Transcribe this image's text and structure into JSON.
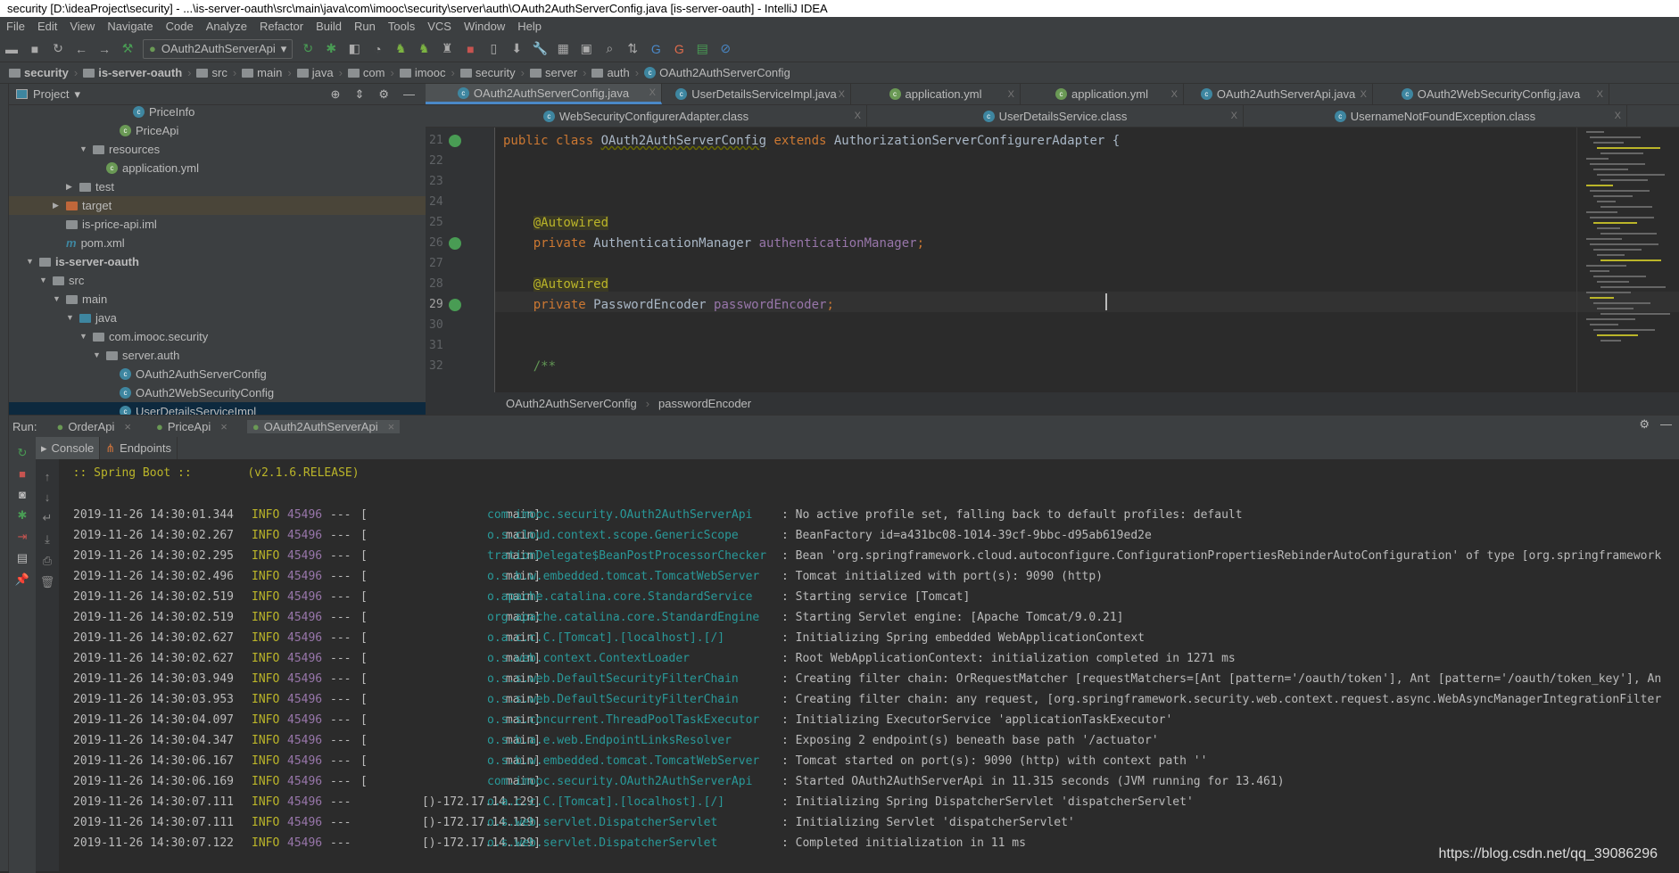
{
  "window": {
    "title": "security [D:\\ideaProject\\security] - ...\\is-server-oauth\\src\\main\\java\\com\\imooc\\security\\server\\auth\\OAuth2AuthServerConfig.java [is-server-oauth] - IntelliJ IDEA"
  },
  "menu": [
    "File",
    "Edit",
    "View",
    "Navigate",
    "Code",
    "Analyze",
    "Refactor",
    "Build",
    "Run",
    "Tools",
    "VCS",
    "Window",
    "Help"
  ],
  "toolbar": {
    "run_config": "OAuth2AuthServerApi"
  },
  "breadcrumb": [
    "security",
    "is-server-oauth",
    "src",
    "main",
    "java",
    "com",
    "imooc",
    "security",
    "server",
    "auth",
    "OAuth2AuthServerConfig"
  ],
  "project": {
    "title": "Project",
    "tree": [
      {
        "label": "PriceInfo",
        "depth": 8,
        "icon": "class"
      },
      {
        "label": "PriceApi",
        "depth": 7,
        "icon": "spring-class"
      },
      {
        "label": "resources",
        "depth": 5,
        "icon": "folder",
        "open": true
      },
      {
        "label": "application.yml",
        "depth": 6,
        "icon": "yml"
      },
      {
        "label": "test",
        "depth": 4,
        "icon": "folder",
        "open": false
      },
      {
        "label": "target",
        "depth": 3,
        "icon": "folder-orange",
        "open": false
      },
      {
        "label": "is-price-api.iml",
        "depth": 3,
        "icon": "file"
      },
      {
        "label": "pom.xml",
        "depth": 3,
        "icon": "maven"
      },
      {
        "label": "is-server-oauth",
        "depth": 1,
        "icon": "module",
        "open": true
      },
      {
        "label": "src",
        "depth": 2,
        "icon": "folder",
        "open": true
      },
      {
        "label": "main",
        "depth": 3,
        "icon": "folder",
        "open": true
      },
      {
        "label": "java",
        "depth": 4,
        "icon": "folder-blue",
        "open": true
      },
      {
        "label": "com.imooc.security",
        "depth": 5,
        "icon": "package",
        "open": true
      },
      {
        "label": "server.auth",
        "depth": 6,
        "icon": "package",
        "open": true
      },
      {
        "label": "OAuth2AuthServerConfig",
        "depth": 7,
        "icon": "class"
      },
      {
        "label": "OAuth2WebSecurityConfig",
        "depth": 7,
        "icon": "class"
      },
      {
        "label": "UserDetailsServiceImpl",
        "depth": 7,
        "icon": "class",
        "selected": true
      }
    ]
  },
  "tabs_row1": [
    {
      "label": "OAuth2AuthServerConfig.java",
      "active": true
    },
    {
      "label": "UserDetailsServiceImpl.java"
    },
    {
      "label": "application.yml"
    },
    {
      "label": "application.yml"
    },
    {
      "label": "OAuth2AuthServerApi.java"
    },
    {
      "label": "OAuth2WebSecurityConfig.java"
    }
  ],
  "tabs_row2": [
    {
      "label": "WebSecurityConfigurerAdapter.class"
    },
    {
      "label": "UserDetailsService.class"
    },
    {
      "label": "UsernameNotFoundException.class"
    }
  ],
  "editor": {
    "lines": [
      {
        "n": "21",
        "parts": [
          [
            "kw",
            "public class "
          ],
          [
            "u",
            "OAuth2AuthServerConfig"
          ],
          [
            "kw",
            " extends "
          ],
          [
            "",
            "AuthorizationServerConfigurerAdapter {"
          ]
        ]
      },
      {
        "n": "22",
        "parts": []
      },
      {
        "n": "23",
        "parts": []
      },
      {
        "n": "24",
        "parts": []
      },
      {
        "n": "25",
        "parts": [
          [
            "",
            "    "
          ],
          [
            "an",
            "@Autowired"
          ]
        ]
      },
      {
        "n": "26",
        "parts": [
          [
            "kw",
            "    private "
          ],
          [
            "",
            "AuthenticationManager "
          ],
          [
            "fld",
            "authenticationManager"
          ],
          [
            "kw",
            ";"
          ]
        ]
      },
      {
        "n": "27",
        "parts": []
      },
      {
        "n": "28",
        "parts": [
          [
            "",
            "    "
          ],
          [
            "an",
            "@Autowired"
          ]
        ]
      },
      {
        "n": "29",
        "parts": [
          [
            "kw",
            "    private "
          ],
          [
            "",
            "PasswordEncoder "
          ],
          [
            "fld",
            "passwordEncoder"
          ],
          [
            "kw",
            ";"
          ]
        ]
      },
      {
        "n": "30",
        "parts": []
      },
      {
        "n": "31",
        "parts": []
      },
      {
        "n": "32",
        "parts": [
          [
            "cm",
            "    /**"
          ]
        ]
      }
    ],
    "breadcrumb": [
      "OAuth2AuthServerConfig",
      "passwordEncoder"
    ]
  },
  "run": {
    "label": "Run:",
    "tabs": [
      "OrderApi",
      "PriceApi",
      "OAuth2AuthServerApi"
    ],
    "subtabs": [
      "Console",
      "Endpoints"
    ],
    "banner": "  :: Spring Boot ::        (v2.1.6.RELEASE)",
    "log": [
      [
        "2019-11-26 14:30:01.344",
        "INFO",
        "45496",
        "---",
        "main]",
        "com.imooc.security.OAuth2AuthServerApi",
        ": No active profile set, falling back to default profiles: default"
      ],
      [
        "2019-11-26 14:30:02.267",
        "INFO",
        "45496",
        "---",
        "main]",
        "o.s.cloud.context.scope.GenericScope",
        ": BeanFactory id=a431bc08-1014-39cf-9bbc-d95ab619ed2e"
      ],
      [
        "2019-11-26 14:30:02.295",
        "INFO",
        "45496",
        "---",
        "main]",
        "trationDelegate$BeanPostProcessorChecker",
        ": Bean 'org.springframework.cloud.autoconfigure.ConfigurationPropertiesRebinderAutoConfiguration' of type [org.springframework"
      ],
      [
        "2019-11-26 14:30:02.496",
        "INFO",
        "45496",
        "---",
        "main]",
        "o.s.b.w.embedded.tomcat.TomcatWebServer",
        ": Tomcat initialized with port(s): 9090 (http)"
      ],
      [
        "2019-11-26 14:30:02.519",
        "INFO",
        "45496",
        "---",
        "main]",
        "o.apache.catalina.core.StandardService",
        ": Starting service [Tomcat]"
      ],
      [
        "2019-11-26 14:30:02.519",
        "INFO",
        "45496",
        "---",
        "main]",
        "org.apache.catalina.core.StandardEngine",
        ": Starting Servlet engine: [Apache Tomcat/9.0.21]"
      ],
      [
        "2019-11-26 14:30:02.627",
        "INFO",
        "45496",
        "---",
        "main]",
        "o.a.c.c.C.[Tomcat].[localhost].[/]",
        ": Initializing Spring embedded WebApplicationContext"
      ],
      [
        "2019-11-26 14:30:02.627",
        "INFO",
        "45496",
        "---",
        "main]",
        "o.s.web.context.ContextLoader",
        ": Root WebApplicationContext: initialization completed in 1271 ms"
      ],
      [
        "2019-11-26 14:30:03.949",
        "INFO",
        "45496",
        "---",
        "main]",
        "o.s.s.web.DefaultSecurityFilterChain",
        ": Creating filter chain: OrRequestMatcher [requestMatchers=[Ant [pattern='/oauth/token'], Ant [pattern='/oauth/token_key'], An"
      ],
      [
        "2019-11-26 14:30:03.953",
        "INFO",
        "45496",
        "---",
        "main]",
        "o.s.s.web.DefaultSecurityFilterChain",
        ": Creating filter chain: any request, [org.springframework.security.web.context.request.async.WebAsyncManagerIntegrationFilter"
      ],
      [
        "2019-11-26 14:30:04.097",
        "INFO",
        "45496",
        "---",
        "main]",
        "o.s.s.concurrent.ThreadPoolTaskExecutor",
        ": Initializing ExecutorService 'applicationTaskExecutor'"
      ],
      [
        "2019-11-26 14:30:04.347",
        "INFO",
        "45496",
        "---",
        "main]",
        "o.s.b.a.e.web.EndpointLinksResolver",
        ": Exposing 2 endpoint(s) beneath base path '/actuator'"
      ],
      [
        "2019-11-26 14:30:06.167",
        "INFO",
        "45496",
        "---",
        "main]",
        "o.s.b.w.embedded.tomcat.TomcatWebServer",
        ": Tomcat started on port(s): 9090 (http) with context path ''"
      ],
      [
        "2019-11-26 14:30:06.169",
        "INFO",
        "45496",
        "---",
        "main]",
        "com.imooc.security.OAuth2AuthServerApi",
        ": Started OAuth2AuthServerApi in 11.315 seconds (JVM running for 13.461)"
      ],
      [
        "2019-11-26 14:30:07.111",
        "INFO",
        "45496",
        "---",
        "[)-172.17.14.129]",
        "o.a.c.c.C.[Tomcat].[localhost].[/]",
        ": Initializing Spring DispatcherServlet 'dispatcherServlet'"
      ],
      [
        "2019-11-26 14:30:07.111",
        "INFO",
        "45496",
        "---",
        "[)-172.17.14.129]",
        "o.s.web.servlet.DispatcherServlet",
        ": Initializing Servlet 'dispatcherServlet'"
      ],
      [
        "2019-11-26 14:30:07.122",
        "INFO",
        "45496",
        "---",
        "[)-172.17.14.129]",
        "o.s.web.servlet.DispatcherServlet",
        ": Completed initialization in 11 ms"
      ]
    ]
  },
  "watermark": "https://blog.csdn.net/qq_39086296"
}
